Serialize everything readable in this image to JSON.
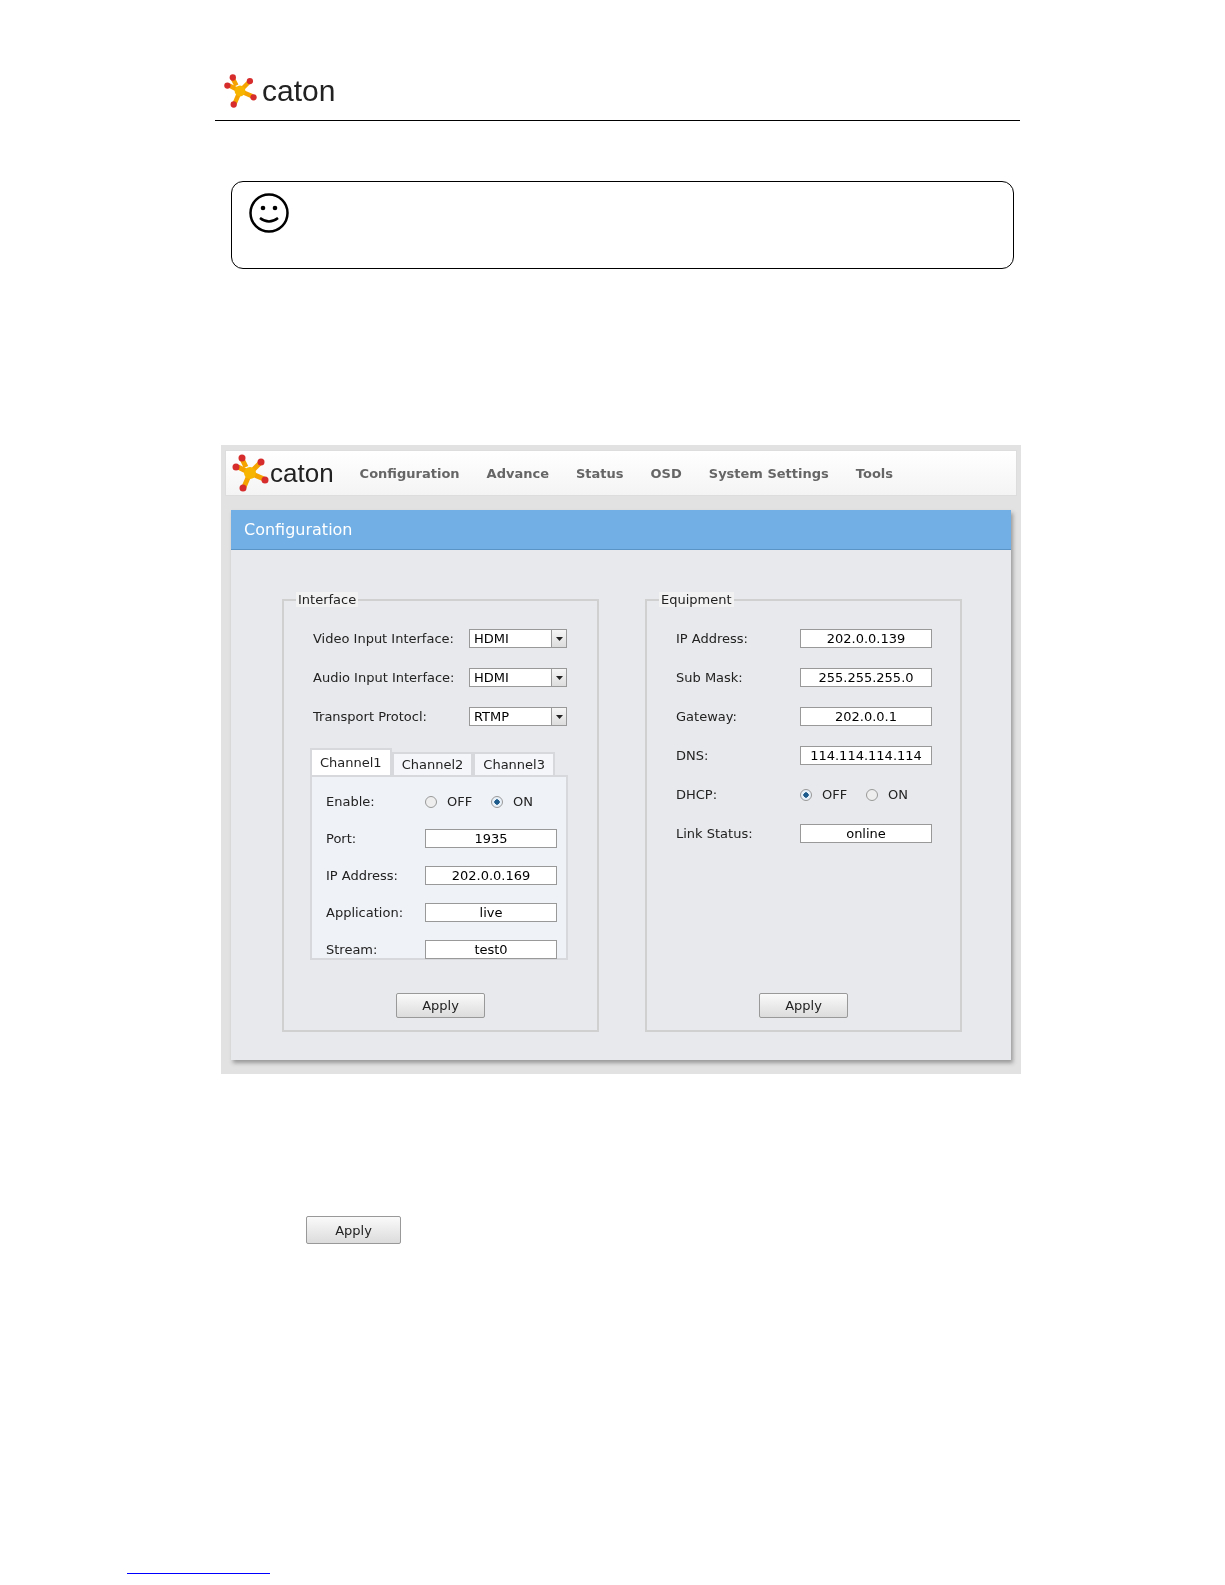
{
  "header": {
    "logo_text": "caton"
  },
  "app": {
    "logo_text": "caton",
    "nav": [
      {
        "label": "Configuration",
        "selected": false
      },
      {
        "label": "Advance",
        "selected": false
      },
      {
        "label": "Status",
        "selected": false
      },
      {
        "label": "OSD",
        "selected": false
      },
      {
        "label": "System Settings",
        "selected": false
      },
      {
        "label": "Tools",
        "selected": false
      }
    ],
    "section_title": "Configuration",
    "interface": {
      "legend": "Interface",
      "fields": [
        {
          "kind": "select",
          "label": "Video Input Interface:",
          "value": "HDMI"
        },
        {
          "kind": "select",
          "label": "Audio Input Interface:",
          "value": "HDMI"
        },
        {
          "kind": "select",
          "label": "Transport Protocl:",
          "value": "RTMP"
        }
      ],
      "tabs": [
        {
          "label": "Channel1",
          "selected": true
        },
        {
          "label": "Channel2",
          "selected": false
        },
        {
          "label": "Channel3",
          "selected": false
        }
      ],
      "channel_fields": [
        {
          "kind": "radio",
          "label": "Enable:",
          "options": [
            {
              "label": "OFF",
              "selected": false
            },
            {
              "label": "ON",
              "selected": true
            }
          ]
        },
        {
          "kind": "input",
          "label": "Port:",
          "value": "1935"
        },
        {
          "kind": "input",
          "label": "IP Address:",
          "value": "202.0.0.169"
        },
        {
          "kind": "input",
          "label": "Application:",
          "value": "live"
        },
        {
          "kind": "input",
          "label": "Stream:",
          "value": "test0"
        }
      ],
      "button": "Apply"
    },
    "equipment": {
      "legend": "Equipment",
      "fields": [
        {
          "kind": "input",
          "label": "IP Address:",
          "value": "202.0.0.139"
        },
        {
          "kind": "input",
          "label": "Sub Mask:",
          "value": "255.255.255.0"
        },
        {
          "kind": "input",
          "label": "Gateway:",
          "value": "202.0.0.1"
        },
        {
          "kind": "input",
          "label": "DNS:",
          "value": "114.114.114.114"
        },
        {
          "kind": "radio",
          "label": "DHCP:",
          "options": [
            {
              "label": "OFF",
              "selected": true
            },
            {
              "label": "ON",
              "selected": false
            }
          ]
        },
        {
          "kind": "input",
          "label": "Link Status:",
          "value": "online"
        }
      ],
      "button": "Apply"
    }
  },
  "bottom_button": "Apply"
}
